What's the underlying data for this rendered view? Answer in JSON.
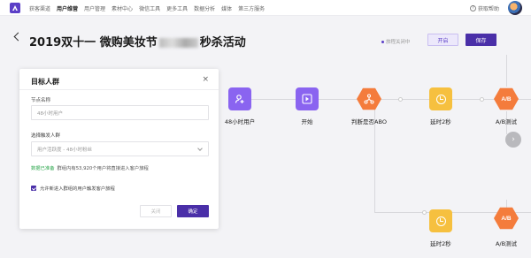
{
  "nav": {
    "items": [
      "获客渠道",
      "用户维营",
      "用户管理",
      "素材中心",
      "微信工具",
      "更多工具",
      "数据分析",
      "媒体",
      "第三方服务"
    ],
    "active_index": 1,
    "help_label": "获取帮助"
  },
  "header": {
    "title_prefix": "2019双十一 微购美妆节",
    "title_suffix": "秒杀活动",
    "status_text": "旅程关闭中",
    "pause_label": "开启",
    "save_label": "保存"
  },
  "flow": {
    "nodes": [
      {
        "label": "48小时用户",
        "icon": "user-plus-icon",
        "color": "#8a64f0"
      },
      {
        "label": "开始",
        "icon": "play-icon",
        "color": "#8a64f0"
      },
      {
        "label": "判断是否ABO",
        "icon": "branch-icon",
        "color": "#f47c3c"
      },
      {
        "label": "延时2秒",
        "icon": "clock-icon",
        "color": "#f6c03f"
      },
      {
        "label": "A/B测试",
        "icon": "ab-icon",
        "color": "#f47c3c"
      },
      {
        "label": "延时2秒",
        "icon": "clock-icon",
        "color": "#f6c03f"
      },
      {
        "label": "A/B测试",
        "icon": "ab-icon",
        "color": "#f47c3c"
      }
    ],
    "ab_text": "A/B",
    "next_arrow": "›"
  },
  "panel": {
    "title": "目标人群",
    "close_glyph": "×",
    "node_name_label": "节点名称",
    "node_name_value": "48小时用户",
    "trigger_label": "选择触发人群",
    "trigger_value": "用户活跃度 - 48小时粉丝",
    "sync_status": "数据已准备",
    "sync_text": "群组内有53,920个用户将直接进入客户旅程",
    "checkbox_label": "允许新进入群组的用户触发客户旅程",
    "checkbox_checked": true,
    "cancel_label": "关闭",
    "confirm_label": "确定"
  },
  "colors": {
    "accent": "#4a2fa8",
    "purple_node": "#8a64f0",
    "orange_node": "#f47c3c",
    "yellow_node": "#f6c03f",
    "ok_green": "#2fa84f"
  }
}
